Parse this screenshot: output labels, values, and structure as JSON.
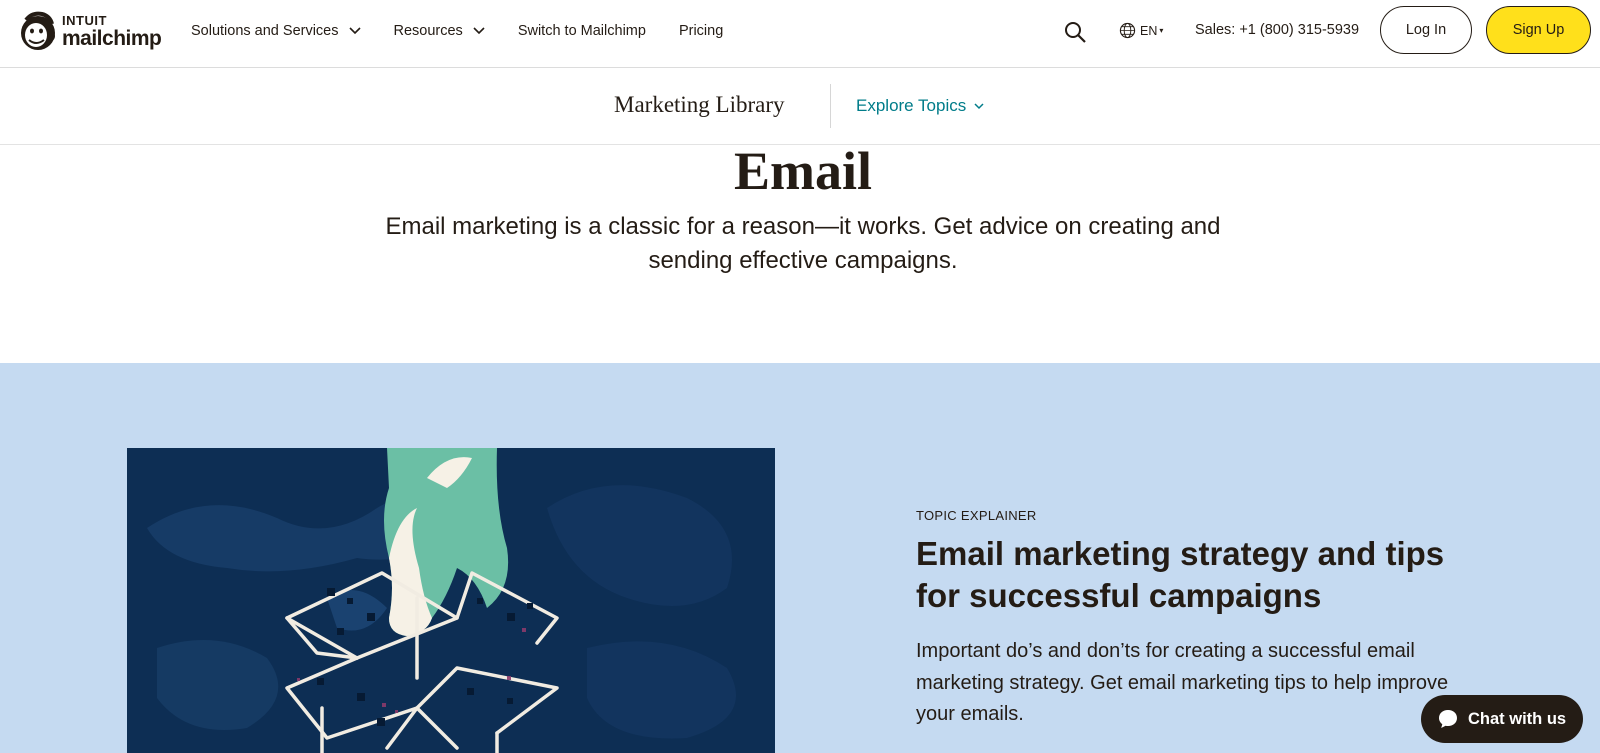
{
  "header": {
    "logo": {
      "line1": "INTUIT",
      "line2": "mailchimp"
    },
    "nav": [
      {
        "label": "Solutions and Services",
        "has_dropdown": true
      },
      {
        "label": "Resources",
        "has_dropdown": true
      },
      {
        "label": "Switch to Mailchimp",
        "has_dropdown": false
      },
      {
        "label": "Pricing",
        "has_dropdown": false
      }
    ],
    "language": "EN",
    "sales": "Sales: +1 (800) 315-5939",
    "login_label": "Log In",
    "signup_label": "Sign Up",
    "signup_color": "#ffe01b"
  },
  "subnav": {
    "title": "Marketing Library",
    "explore_label": "Explore Topics",
    "explore_color": "#007c89"
  },
  "hero": {
    "title": "Email",
    "description": "Email marketing is a classic for a reason—it works. Get advice on creating and sending effective campaigns."
  },
  "feature": {
    "band_color": "#c5daf1",
    "image_icon": "hand-opening-box-illustration",
    "eyebrow": "TOPIC EXPLAINER",
    "title": "Email marketing strategy and tips for successful campaigns",
    "description": "Important do’s and don’ts for creating a successful email marketing strategy. Get email marketing tips to help improve your emails."
  },
  "chat": {
    "label": "Chat with us",
    "icon": "chat-bubble-icon"
  }
}
